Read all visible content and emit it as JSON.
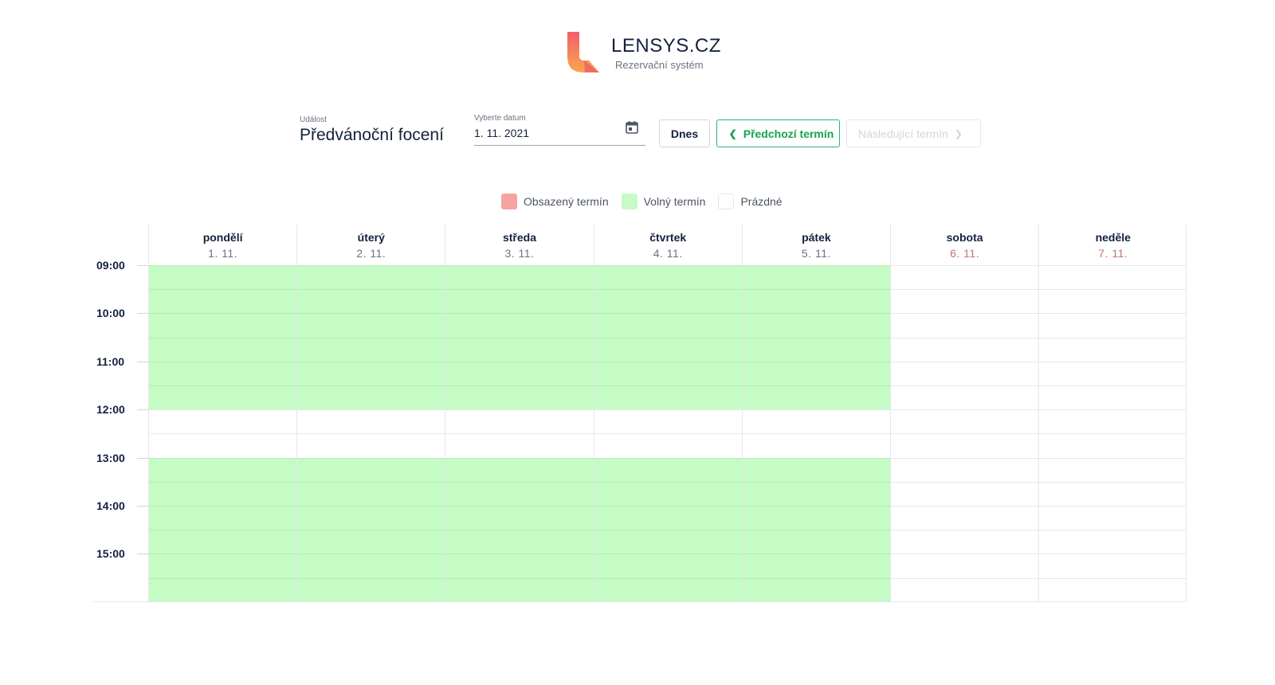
{
  "brand": {
    "title": "LENSYS.CZ",
    "subtitle": "Rezervační systém",
    "logo_icon": "lensys-logo-icon",
    "colors": {
      "logo_red": "#f25f6b",
      "logo_orange": "#f9a74d"
    }
  },
  "toolbar": {
    "event_label": "Událost",
    "event_name": "Předvánoční focení",
    "date_label": "Vyberte datum",
    "date_value": "1. 11. 2021",
    "calendar_icon": "calendar-icon",
    "today_label": "Dnes",
    "prev_label": "Předchozí termín",
    "next_label": "Následující termín",
    "next_disabled": true
  },
  "legend": {
    "busy": "Obsazený termín",
    "free": "Volný termín",
    "empty": "Prázdné",
    "colors": {
      "busy": "#f5a3a3",
      "free": "#c5fbc5",
      "empty": "#ffffff"
    }
  },
  "days": [
    {
      "name": "pondělí",
      "date": "1. 11.",
      "weekend": false
    },
    {
      "name": "úterý",
      "date": "2. 11.",
      "weekend": false
    },
    {
      "name": "středa",
      "date": "3. 11.",
      "weekend": false
    },
    {
      "name": "čtvrtek",
      "date": "4. 11.",
      "weekend": false
    },
    {
      "name": "pátek",
      "date": "5. 11.",
      "weekend": false
    },
    {
      "name": "sobota",
      "date": "6. 11.",
      "weekend": true
    },
    {
      "name": "neděle",
      "date": "7. 11.",
      "weekend": true
    }
  ],
  "hours": [
    "09:00",
    "10:00",
    "11:00",
    "12:00",
    "13:00",
    "14:00",
    "15:00"
  ],
  "slots_per_day": 14,
  "slot_status": [
    [
      "free",
      "free",
      "free",
      "free",
      "free",
      "free",
      "empty",
      "empty",
      "free",
      "free",
      "free",
      "free",
      "free",
      "free"
    ],
    [
      "free",
      "free",
      "free",
      "free",
      "free",
      "free",
      "empty",
      "empty",
      "free",
      "free",
      "free",
      "free",
      "free",
      "free"
    ],
    [
      "free",
      "free",
      "free",
      "free",
      "free",
      "free",
      "empty",
      "empty",
      "free",
      "free",
      "free",
      "free",
      "free",
      "free"
    ],
    [
      "free",
      "free",
      "free",
      "free",
      "free",
      "free",
      "empty",
      "empty",
      "free",
      "free",
      "free",
      "free",
      "free",
      "free"
    ],
    [
      "free",
      "free",
      "free",
      "free",
      "free",
      "free",
      "empty",
      "empty",
      "free",
      "free",
      "free",
      "free",
      "free",
      "free"
    ],
    [
      "empty",
      "empty",
      "empty",
      "empty",
      "empty",
      "empty",
      "empty",
      "empty",
      "empty",
      "empty",
      "empty",
      "empty",
      "empty",
      "empty"
    ],
    [
      "empty",
      "empty",
      "empty",
      "empty",
      "empty",
      "empty",
      "empty",
      "empty",
      "empty",
      "empty",
      "empty",
      "empty",
      "empty",
      "empty"
    ]
  ]
}
